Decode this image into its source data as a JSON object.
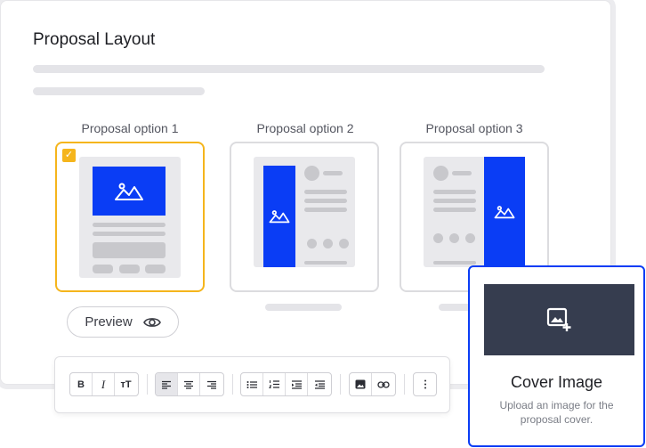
{
  "page": {
    "title": "Proposal Layout"
  },
  "options": [
    {
      "label": "Proposal option 1",
      "selected": true
    },
    {
      "label": "Proposal option 2",
      "selected": false
    },
    {
      "label": "Proposal option 3",
      "selected": false
    }
  ],
  "preview": {
    "label": "Preview",
    "icon": "eye-icon"
  },
  "toolbar": {
    "bold": "B",
    "italic": "I",
    "text_size": "тT",
    "icons": [
      "align-left-icon",
      "align-center-icon",
      "align-right-icon",
      "bullet-list-icon",
      "numbered-list-icon",
      "indent-icon",
      "outdent-icon",
      "image-icon",
      "link-icon",
      "more-icon"
    ]
  },
  "cover": {
    "title": "Cover Image",
    "description": "Upload an image for the proposal cover.",
    "icon": "add-image-icon"
  },
  "colors": {
    "accent": "#0a3df5",
    "selected": "#f5b51c",
    "cover_bg": "#363d4f"
  }
}
